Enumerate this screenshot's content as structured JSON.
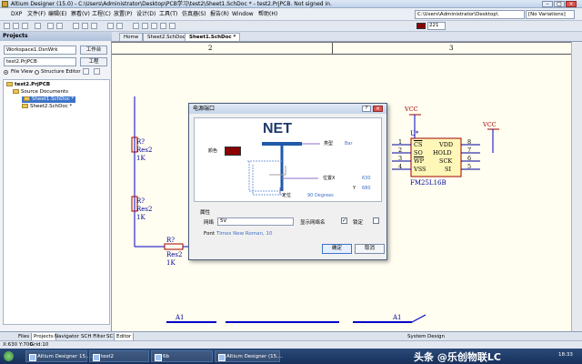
{
  "window": {
    "title": "Altium Designer (15.0) - C:\\Users\\Administrator\\Desktop\\PCB学习\\test2\\Sheet1.SchDoc * - test2.PrjPCB. Not signed in.",
    "minimize": "–",
    "maximize": "□",
    "close": "×"
  },
  "menu": {
    "items": [
      "DXP",
      "文件(F)",
      "编辑(E)",
      "察看(V)",
      "工程(C)",
      "放置(P)",
      "设计(D)",
      "工具(T)",
      "仿真器(S)",
      "报告(R)",
      "Window",
      "帮助(H)"
    ],
    "path": "C:\\Users\\Administrator\\Desktop\\",
    "variations": "[No Variations]"
  },
  "toolbar": {
    "zoom": "221",
    "accent_color": "#8b0000"
  },
  "panel": {
    "title": "Projects",
    "workspace": "Workspace1.DsnWrk",
    "workspace_button": "工作台",
    "project": "test2.PrjPCB",
    "project_button": "工程",
    "file_view": "File View",
    "structure_editor": "Structure Editor",
    "tree": {
      "project": "test2.PrjPCB",
      "folder": "Source Documents",
      "docs": [
        "Sheet1.SchDoc *",
        "Sheet2.SchDoc *"
      ]
    },
    "tabs": [
      "Files",
      "Projects",
      "Navigator",
      "SCH Filter",
      "SCH"
    ]
  },
  "doc_tabs": [
    "Home",
    "Sheet2.SchDoc",
    "Sheet1.SchDoc *"
  ],
  "schematic": {
    "zones": [
      "2",
      "3"
    ],
    "resistors": [
      {
        "des": "R?",
        "comment": "Res2",
        "value": "1K"
      },
      {
        "des": "R?",
        "comment": "Res2",
        "value": "1K"
      },
      {
        "des": "R?",
        "comment": "Res2",
        "value": "1K"
      }
    ],
    "power_ports": [
      "VCC",
      "VCC"
    ],
    "chip": {
      "designator": "U*",
      "part": "FM25L16B",
      "left_pins": [
        {
          "num": "1",
          "name": "CS"
        },
        {
          "num": "2",
          "name": "SO"
        },
        {
          "num": "3",
          "name": "WP"
        },
        {
          "num": "4",
          "name": "VSS"
        }
      ],
      "right_pins": [
        {
          "num": "8",
          "name": "VDD"
        },
        {
          "num": "7",
          "name": "HOLD"
        },
        {
          "num": "6",
          "name": "SCK"
        },
        {
          "num": "5",
          "name": "SI"
        }
      ]
    },
    "net_labels": [
      "A1",
      "A1"
    ]
  },
  "dialog": {
    "title": "电源端口",
    "preview": {
      "net": "NET",
      "color_label": "颜色",
      "type_label": "类型",
      "type_value": "Bar",
      "location_label": "位置X",
      "x_value": "630",
      "y_label": "Y",
      "y_value": "680",
      "orientation_label": "定位",
      "orientation_value": "90 Degrees"
    },
    "properties": {
      "section": "属性",
      "net_label": "网络",
      "net_value": "5V",
      "show_net_label": "显示网络名",
      "lock_label": "锁定",
      "show_net_checked": "✓",
      "font_label": "Font",
      "font_value": "Times New Roman, 10"
    },
    "ok": "确定",
    "cancel": "取消",
    "help": "?",
    "close": "×"
  },
  "status": {
    "coords": "X:630 Y:700",
    "grid": "Grid:10",
    "editor_tab": "Editor",
    "right": [
      "System",
      "Design"
    ]
  },
  "taskbar": {
    "tasks": [
      "Altium Designer 15....",
      "test2",
      "6b",
      "Altium Designer (15...."
    ],
    "time": "18:33",
    "watermark": "头条 @乐创物联LC"
  }
}
